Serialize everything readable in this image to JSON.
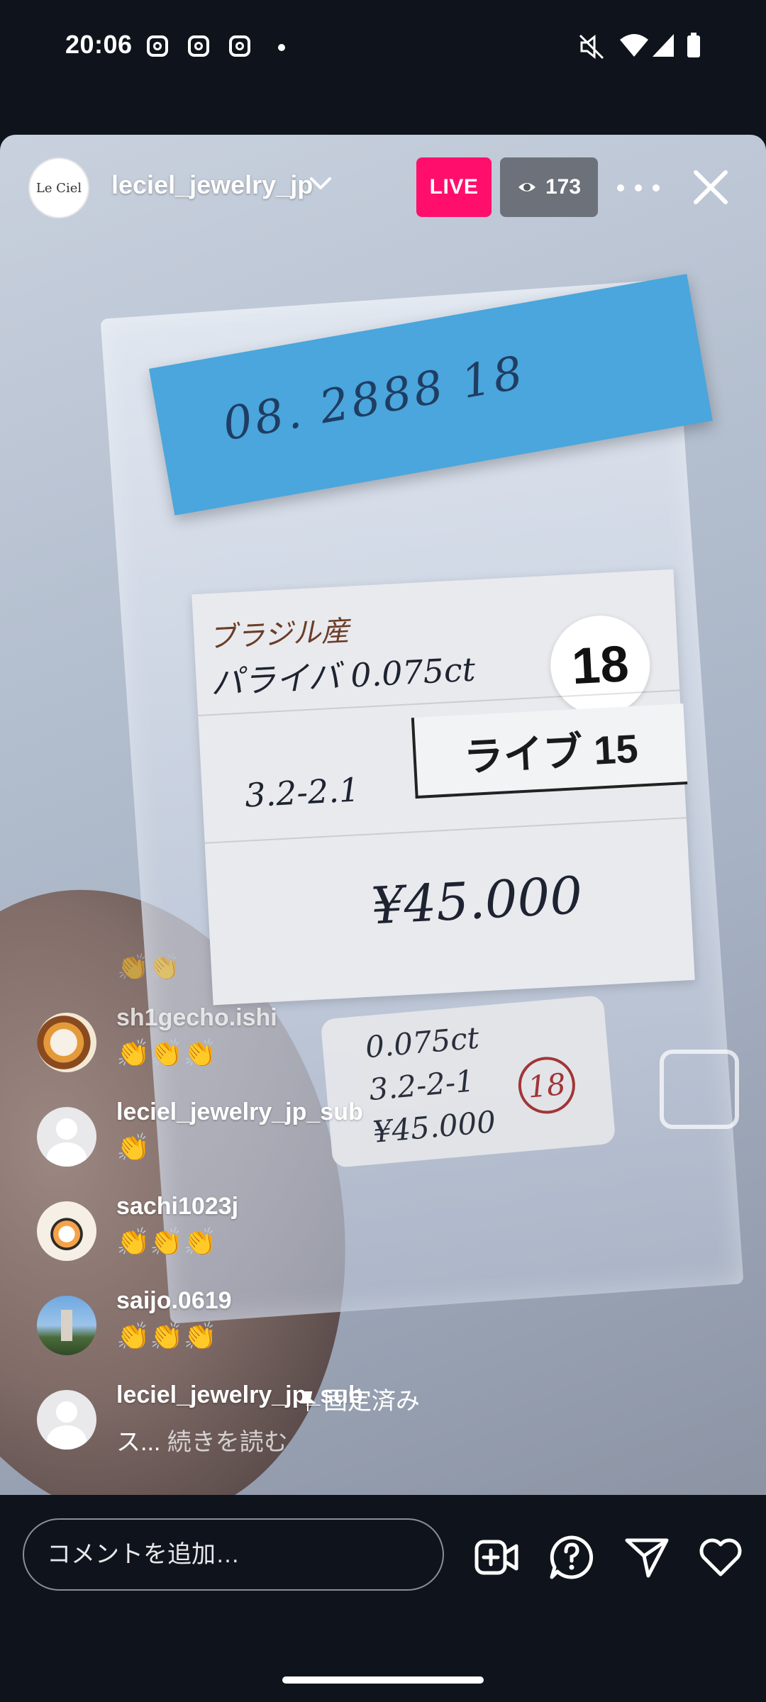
{
  "status_bar": {
    "time": "20:06",
    "left_icons": [
      "instagram-icon",
      "instagram-icon",
      "instagram-icon",
      "dot-icon"
    ],
    "right_icons": [
      "mute-icon",
      "wifi-icon",
      "signal-icon",
      "battery-icon"
    ]
  },
  "live": {
    "username": "leciel_jewelry_jp",
    "avatar_text": "Le Ciel",
    "live_label": "LIVE",
    "viewer_count": "173"
  },
  "video_text": {
    "sticky": "08. 2888    18",
    "label_line1": "ブラジル産",
    "label_line2": "パライバ 0.075ct",
    "number": "18",
    "live_tag": "ライブ 15",
    "code": "3.2-2.1",
    "price": "¥45.000",
    "small_card": [
      "0.075ct",
      "3.2-2-1",
      "¥45.000"
    ],
    "small_circle": "18"
  },
  "comments": {
    "faded": "👏👏",
    "items": [
      {
        "user": "sh1gecho.ishi",
        "text": "👏👏👏"
      },
      {
        "user": "leciel_jewelry_jp_sub",
        "text": "👏"
      },
      {
        "user": "sachi1023j",
        "text": "👏👏👏"
      },
      {
        "user": "saijo.0619",
        "text": "👏👏👏"
      }
    ],
    "pinned": {
      "user": "leciel_jewelry_jp_sub",
      "pin_label": "固定済み",
      "text_start": "ス...",
      "read_more": "続きを読む"
    }
  },
  "bottom": {
    "comment_placeholder": "コメントを追加…",
    "icons": [
      "add-video-icon",
      "question-icon",
      "send-icon",
      "heart-icon"
    ]
  },
  "colors": {
    "live_badge": "#ff0f6b",
    "sticky_note": "#4aa6dc",
    "background": "#0f141c"
  }
}
